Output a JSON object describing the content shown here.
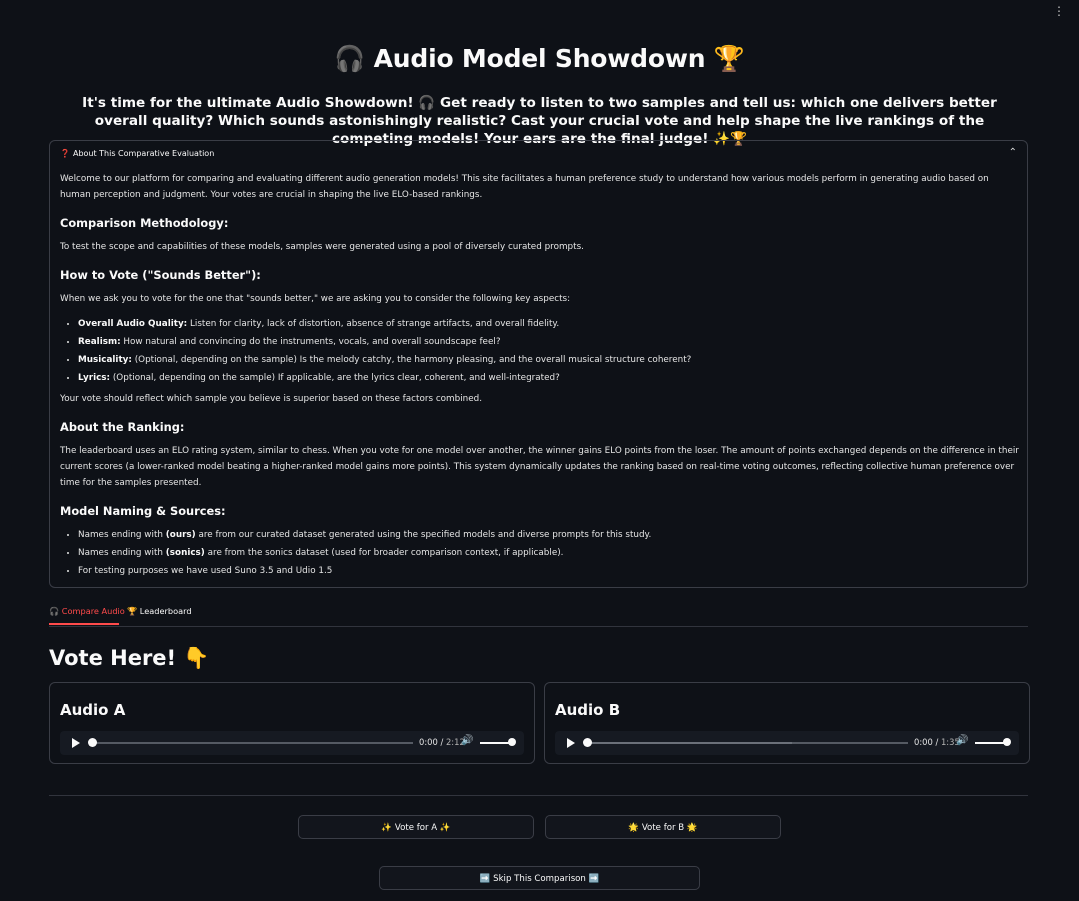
{
  "app": {
    "menu_icon": "vertical-dots-icon",
    "title": "🎧 Audio Model Showdown 🏆",
    "subtitle": "It's time for the ultimate Audio Showdown! 🎧 Get ready to listen to two samples and tell us: which one delivers better overall quality? Which sounds astonishingly realistic? Cast your crucial vote and help shape the live rankings of the competing models! Your ears are the final judge! ✨🏆"
  },
  "about": {
    "header_icon": "❓",
    "header": "About This Comparative Evaluation",
    "intro": "Welcome to our platform for comparing and evaluating different audio generation models! This site facilitates a human preference study to understand how various models perform in generating audio based on human perception and judgment. Your votes are crucial in shaping the live ELO-based rankings.",
    "methodology_heading": "Comparison Methodology:",
    "methodology_text": "To test the scope and capabilities of these models, samples were generated using a pool of diversely curated prompts.",
    "howto_heading": "How to Vote (\"Sounds Better\"):",
    "howto_text": "When we ask you to vote for the one that \"sounds better,\" we are asking you to consider the following key aspects:",
    "criteria": [
      {
        "term": "Overall Audio Quality:",
        "desc": " Listen for clarity, lack of distortion, absence of strange artifacts, and overall fidelity."
      },
      {
        "term": "Realism:",
        "desc": " How natural and convincing do the instruments, vocals, and overall soundscape feel?"
      },
      {
        "term": "Musicality:",
        "desc": " (Optional, depending on the sample) Is the melody catchy, the harmony pleasing, and the overall musical structure coherent?"
      },
      {
        "term": "Lyrics:",
        "desc": " (Optional, depending on the sample) If applicable, are the lyrics clear, coherent, and well-integrated?"
      }
    ],
    "criteria_summary": "Your vote should reflect which sample you believe is superior based on these factors combined.",
    "ranking_heading": "About the Ranking:",
    "ranking_text": "The leaderboard uses an ELO rating system, similar to chess. When you vote for one model over another, the winner gains ELO points from the loser. The amount of points exchanged depends on the difference in their current scores (a lower-ranked model beating a higher-ranked model gains more points). This system dynamically updates the ranking based on real-time voting outcomes, reflecting collective human preference over time for the samples presented.",
    "naming_heading": "Model Naming & Sources:",
    "naming": [
      {
        "pre": "Names ending with ",
        "term": "(ours)",
        "post": " are from our curated dataset generated using the specified models and diverse prompts for this study."
      },
      {
        "pre": "Names ending with ",
        "term": "(sonics)",
        "post": " are from the sonics dataset (used for broader comparison context, if applicable)."
      },
      {
        "pre": "For testing purposes we have used Suno 3.5 and Udio 1.5",
        "term": "",
        "post": ""
      }
    ]
  },
  "tabs": [
    {
      "label": "🎧 Compare Audio",
      "active": true
    },
    {
      "label": "🏆 Leaderboard",
      "active": false
    }
  ],
  "compare": {
    "heading": "Vote Here! 👇",
    "audio_a": {
      "title": "Audio A",
      "current": "0:00",
      "duration": "2:12",
      "buffered_fraction": 0.0,
      "volume": 1.0
    },
    "audio_b": {
      "title": "Audio B",
      "current": "0:00",
      "duration": "1:35",
      "buffered_fraction": 0.64,
      "volume": 1.0
    },
    "vote_a_label": "✨ Vote for A ✨",
    "vote_b_label": "🌟 Vote for B 🌟",
    "skip_label": "➡️ Skip This Comparison ➡️"
  },
  "colors": {
    "background": "#0e1117",
    "accent": "#ff4b4b",
    "border": "#3a3d46"
  }
}
